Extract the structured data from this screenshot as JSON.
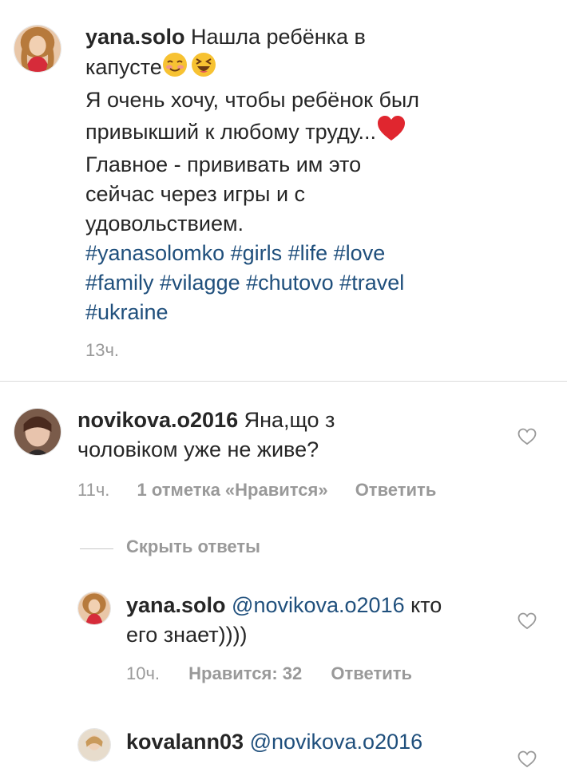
{
  "caption": {
    "username": "yana.solo",
    "text_line1": " Нашла ребёнка в",
    "text_line2": "капусте",
    "text_line3": "Я очень хочу, чтобы ребёнок был",
    "text_line4": "привыкший к любому труду...",
    "text_line5": "Главное - прививать им это",
    "text_line6": "сейчас через игры и с",
    "text_line7": "удовольствием.",
    "hashtags_line1": "#yanasolomko #girls #life #love",
    "hashtags_line2": "#family #vilagge #chutovo #travel",
    "hashtags_line3": "#ukraine",
    "time": "13ч."
  },
  "comment1": {
    "username": "novikova.o2016",
    "text_line1": " Яна,що з",
    "text_line2": "чоловіком уже не живе?",
    "time": "11ч.",
    "likes": "1 отметка «Нравится»",
    "reply_label": "Ответить"
  },
  "replies": {
    "hide_label": "Скрыть ответы"
  },
  "reply1": {
    "username": "yana.solo",
    "mention": " @novikova.o2016",
    "text_line1_end": " кто",
    "text_line2": "его знает))))",
    "time": "10ч.",
    "likes": "Нравится: 32",
    "reply_label": "Ответить"
  },
  "reply2": {
    "username": "kovalann03",
    "mention": " @novikova.o2016"
  },
  "icons": {
    "like": "heart-outline-icon",
    "emoji1": "smiling-blush-emoji",
    "emoji2": "laughing-squint-emoji",
    "emoji3": "red-heart-emoji"
  },
  "colors": {
    "hashtag": "#1f4f7c",
    "meta": "#999999",
    "text": "#262626"
  }
}
